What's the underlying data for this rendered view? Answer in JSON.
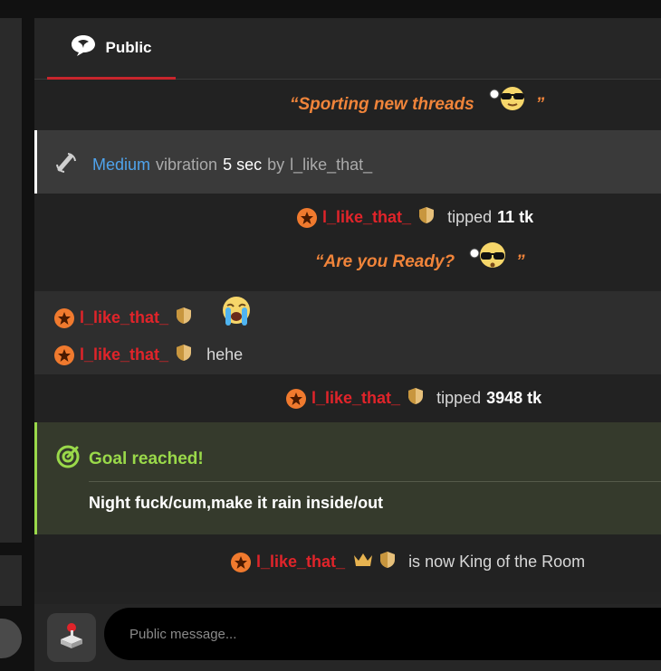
{
  "tab": {
    "label": "Public"
  },
  "messages": {
    "quote1": "“Sporting new threads",
    "quote1_end": "”",
    "vibe": {
      "level": "Medium",
      "word": "vibration",
      "duration": "5 sec",
      "by": "by",
      "user": "l_like_that_"
    },
    "tip1": {
      "user": "l_like_that_",
      "action": "tipped",
      "amount": "11 tk"
    },
    "quote2": "“Are you Ready?",
    "quote2_end": "”",
    "chat1": {
      "user": "l_like_that_"
    },
    "chat2": {
      "user": "l_like_that_",
      "text": "hehe"
    },
    "tip2": {
      "user": "l_like_that_",
      "action": "tipped",
      "amount": "3948 tk"
    },
    "goal": {
      "title": "Goal reached!",
      "text": "Night fuck/cum,make it rain inside/out"
    },
    "king": {
      "user": "l_like_that_",
      "text": "is now King of the Room"
    }
  },
  "composer": {
    "placeholder": "Public message..."
  },
  "colors": {
    "accent": "#c8252c",
    "username": "#e0242a",
    "tip_quote": "#f0843a",
    "vibe_level": "#4fa3ec",
    "goal": "#9ad94a"
  },
  "icons": [
    "chat-bubble-icon",
    "vibration-icon",
    "star-badge-icon",
    "shield-icon",
    "sunglasses-emoji-icon",
    "crying-emoji-icon",
    "target-icon",
    "crown-icon",
    "joystick-icon"
  ]
}
